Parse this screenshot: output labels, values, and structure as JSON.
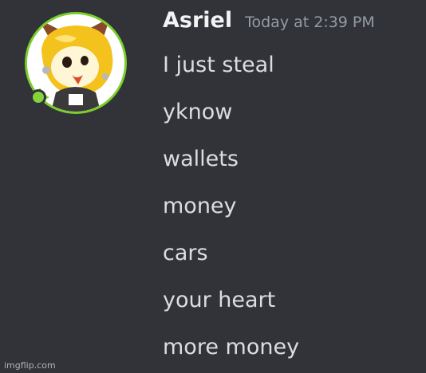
{
  "message": {
    "author": "Asriel",
    "timestamp": "Today at 2:39 PM",
    "avatar_icon": "avatar-image",
    "status_color": "#86d23a",
    "lines": [
      "I just steal",
      "yknow",
      "wallets",
      "money",
      "cars",
      "your heart",
      "more money"
    ]
  },
  "watermark": "imgflip.com",
  "colors": {
    "background": "#313338",
    "username": "#f2f3f5",
    "timestamp": "#949ba4",
    "text": "#dbdee1",
    "avatar_ring": "#7ccf2a"
  }
}
